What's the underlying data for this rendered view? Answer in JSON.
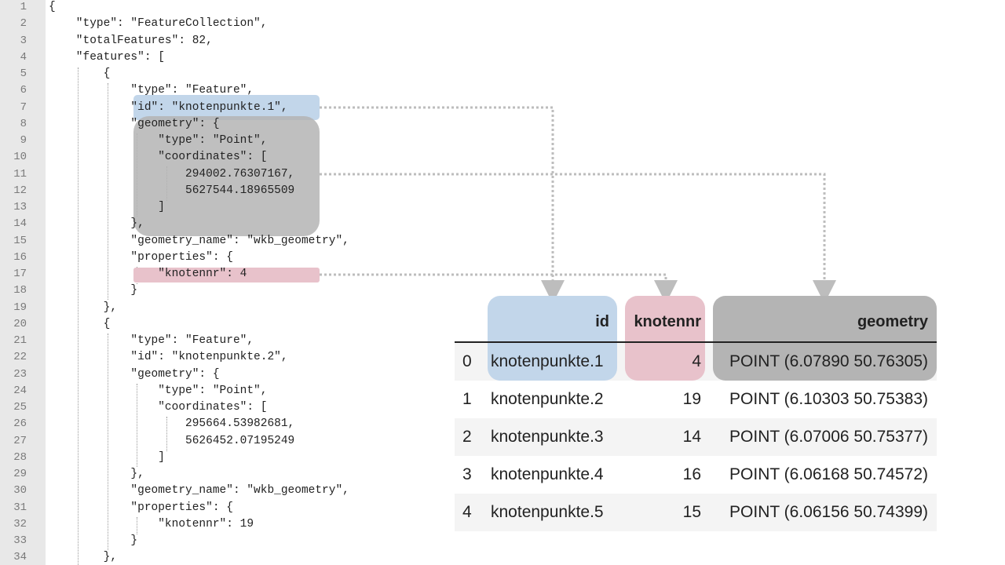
{
  "code_lines": [
    "{",
    "    \"type\": \"FeatureCollection\",",
    "    \"totalFeatures\": 82,",
    "    \"features\": [",
    "        {",
    "            \"type\": \"Feature\",",
    "            \"id\": \"knotenpunkte.1\",",
    "            \"geometry\": {",
    "                \"type\": \"Point\",",
    "                \"coordinates\": [",
    "                    294002.76307167,",
    "                    5627544.18965509",
    "                ]",
    "            },",
    "            \"geometry_name\": \"wkb_geometry\",",
    "            \"properties\": {",
    "                \"knotennr\": 4",
    "            }",
    "        },",
    "        {",
    "            \"type\": \"Feature\",",
    "            \"id\": \"knotenpunkte.2\",",
    "            \"geometry\": {",
    "                \"type\": \"Point\",",
    "                \"coordinates\": [",
    "                    295664.53982681,",
    "                    5626452.07195249",
    "                ]",
    "            },",
    "            \"geometry_name\": \"wkb_geometry\",",
    "            \"properties\": {",
    "                \"knotennr\": 19",
    "            }",
    "        },"
  ],
  "line_numbers": [
    "1",
    "2",
    "3",
    "4",
    "5",
    "6",
    "7",
    "8",
    "9",
    "10",
    "11",
    "12",
    "13",
    "14",
    "15",
    "16",
    "17",
    "18",
    "19",
    "20",
    "21",
    "22",
    "23",
    "24",
    "25",
    "26",
    "27",
    "28",
    "29",
    "30",
    "31",
    "32",
    "33",
    "34"
  ],
  "table": {
    "headers": {
      "index": "",
      "id": "id",
      "knotennr": "knotennr",
      "geometry": "geometry"
    },
    "rows": [
      {
        "index": "0",
        "id": "knotenpunkte.1",
        "knotennr": "4",
        "geometry": "POINT (6.07890 50.76305)"
      },
      {
        "index": "1",
        "id": "knotenpunkte.2",
        "knotennr": "19",
        "geometry": "POINT (6.10303 50.75383)"
      },
      {
        "index": "2",
        "id": "knotenpunkte.3",
        "knotennr": "14",
        "geometry": "POINT (6.07006 50.75377)"
      },
      {
        "index": "3",
        "id": "knotenpunkte.4",
        "knotennr": "16",
        "geometry": "POINT (6.06168 50.74572)"
      },
      {
        "index": "4",
        "id": "knotenpunkte.5",
        "knotennr": "15",
        "geometry": "POINT (6.06156 50.74399)"
      }
    ]
  },
  "colors": {
    "id": "#c2d6ea",
    "knotennr": "#e8c2cb",
    "geometry": "#b4b4b4"
  }
}
